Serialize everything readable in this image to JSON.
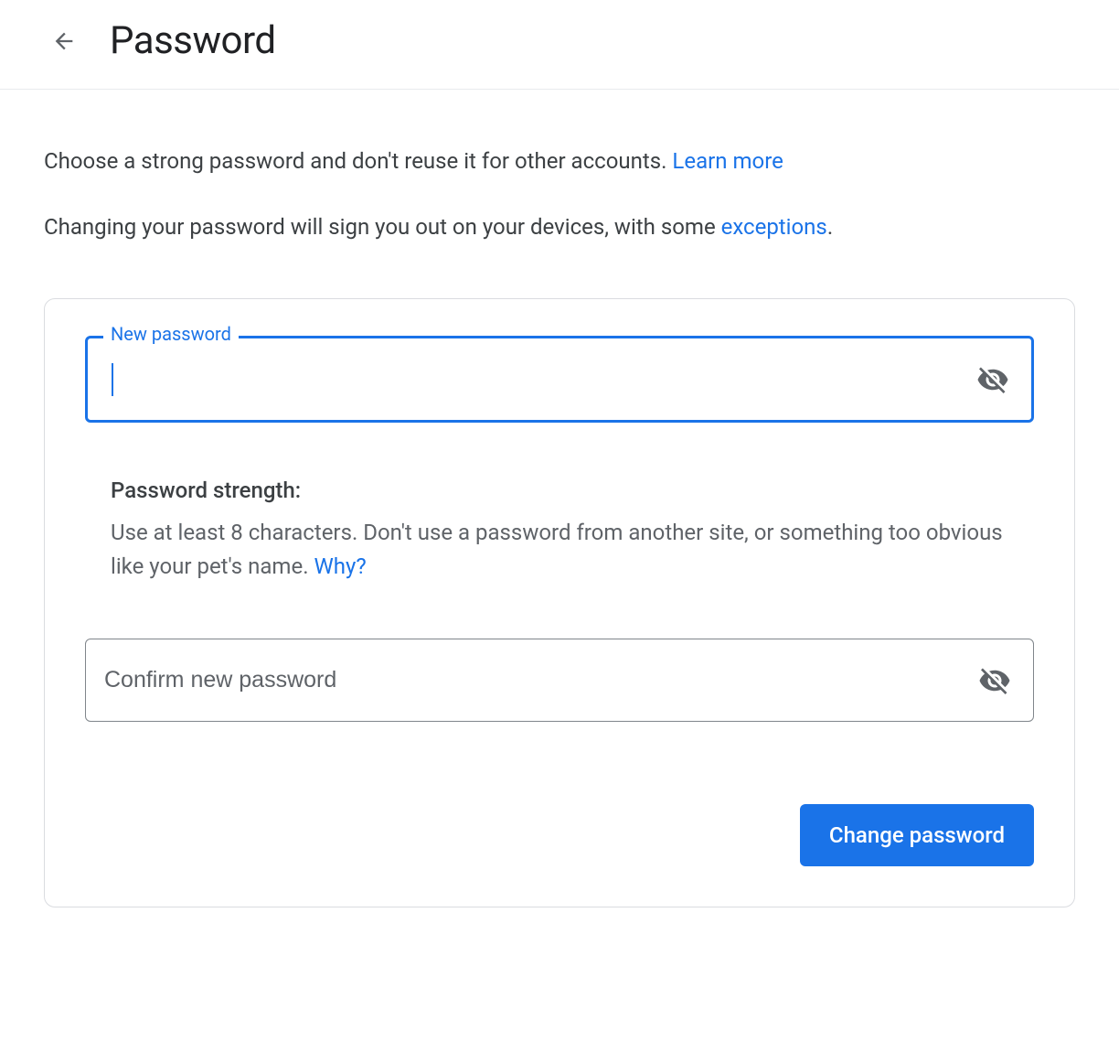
{
  "header": {
    "title": "Password"
  },
  "intro": {
    "line1_pre": "Choose a strong password and don't reuse it for other accounts. ",
    "line1_link": "Learn more",
    "line2_pre": "Changing your password will sign you out on your devices, with some ",
    "line2_link": "exceptions",
    "line2_post": "."
  },
  "form": {
    "new_password_label": "New password",
    "new_password_value": "",
    "confirm_placeholder": "Confirm new password",
    "confirm_value": "",
    "strength_title": "Password strength:",
    "strength_hint_pre": "Use at least 8 characters. Don't use a password from another site, or something too obvious like your pet's name. ",
    "strength_hint_link": "Why?",
    "change_button": "Change password"
  }
}
